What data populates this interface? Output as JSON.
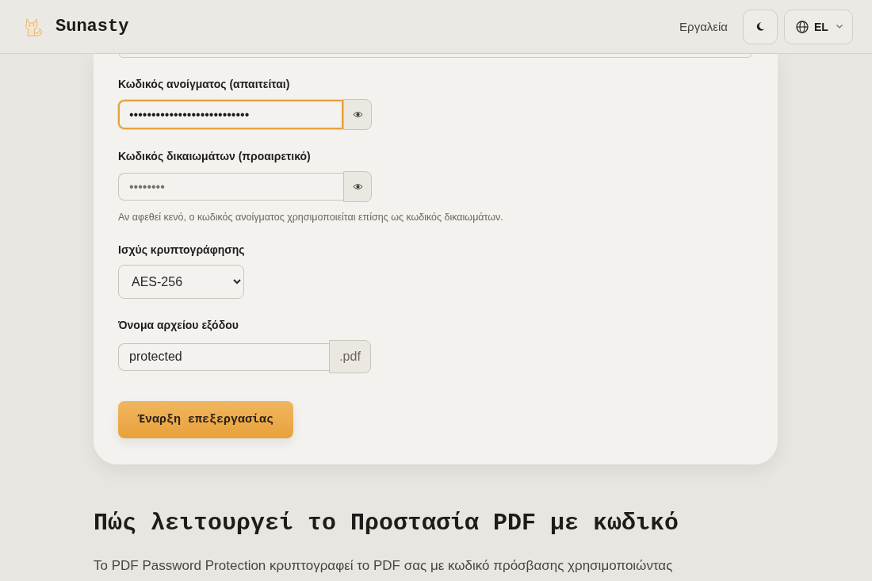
{
  "header": {
    "brand": "Sunasty",
    "nav": [
      {
        "label": "Εργαλεία"
      }
    ],
    "language": {
      "code": "EL"
    }
  },
  "form": {
    "fields": [
      {
        "kind": "password",
        "label": "Κωδικός ανοίγματος (απαιτείται)",
        "value": "•••••••••••••••••••••••••••",
        "focused": true
      },
      {
        "kind": "password",
        "label": "Κωδικός δικαιωμάτων (προαιρετικό)",
        "placeholder": "••••••••",
        "focused": false,
        "hint": "Αν αφεθεί κενό, ο κωδικός ανοίγματος χρησιμοποιείται επίσης ως κωδικός δικαιωμάτων."
      },
      {
        "kind": "select",
        "label": "Ισχύς κρυπτογράφησης",
        "value": "AES-256",
        "focused": false
      },
      {
        "kind": "suffix",
        "label": "Όνομα αρχείου εξόδου",
        "value": "protected",
        "suffix": ".pdf",
        "focused": false
      }
    ],
    "submit": "Έναρξη επεξεργασίας"
  },
  "section": {
    "heading": "Πώς λειτουργεί το Προστασία PDF με κωδικό",
    "text": "Το PDF Password Protection κρυπτογραφεί το PDF σας με κωδικό πρόσβασης χρησιμοποιώντας"
  }
}
